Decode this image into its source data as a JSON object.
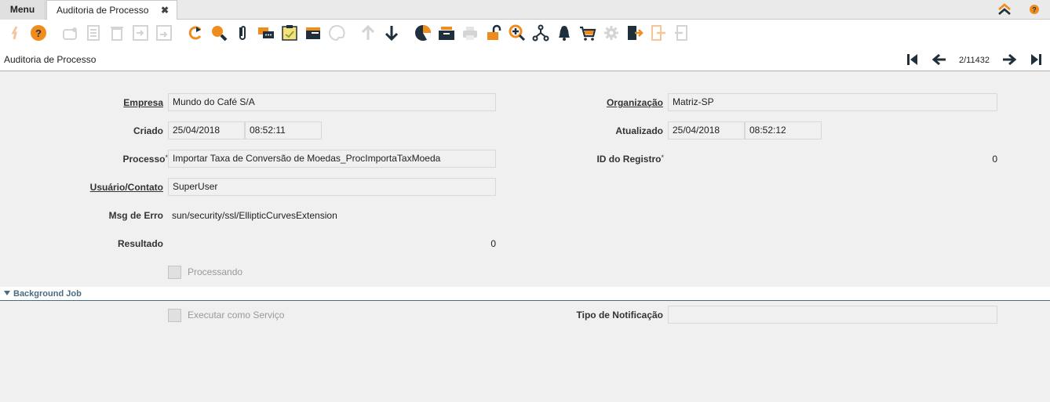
{
  "tabs": {
    "menu_label": "Menu",
    "active_label": "Auditoria de Processo",
    "close_glyph": "✖"
  },
  "toolbar": {
    "icons": [
      "undo-icon",
      "help-icon",
      "new-record-icon",
      "copy-record-icon",
      "delete-icon",
      "save-icon",
      "save-new-icon",
      "refresh-icon",
      "find-icon",
      "attachment-icon",
      "chat-icon",
      "post-it-icon",
      "archive-icon",
      "palette-icon",
      "parent-record-icon",
      "detail-record-icon",
      "chart-icon",
      "report-icon",
      "print-icon",
      "lock-icon",
      "zoom-across-icon",
      "workflow-icon",
      "notification-icon",
      "cart-icon",
      "process-icon",
      "exit-icon",
      "export-icon",
      "import-icon"
    ],
    "accent_color": "#f08c1e",
    "dark_color": "#1f2f3b"
  },
  "header": {
    "title": "Auditoria de Processo",
    "record_count": "2/11432"
  },
  "form": {
    "empresa_label": "Empresa",
    "empresa_value": "Mundo do Café S/A",
    "organizacao_label": "Organização",
    "organizacao_value": "Matriz-SP",
    "criado_label": "Criado",
    "criado_date": "25/04/2018",
    "criado_time": "08:52:11",
    "atualizado_label": "Atualizado",
    "atualizado_date": "25/04/2018",
    "atualizado_time": "08:52:12",
    "processo_label": "Processo",
    "required_mark": "*",
    "processo_value": "Importar Taxa de Conversão de Moedas_ProcImportaTaxMoeda",
    "id_registro_label": "ID do Registro",
    "id_registro_value": "0",
    "usuario_label": "Usuário/Contato",
    "usuario_value": "SuperUser",
    "msg_erro_label": "Msg de Erro",
    "msg_erro_value": "sun/security/ssl/EllipticCurvesExtension",
    "resultado_label": "Resultado",
    "resultado_value": "0",
    "processando_label": "Processando"
  },
  "background_job": {
    "section_title": "Background Job",
    "executar_label": "Executar como Serviço",
    "tipo_notificacao_label": "Tipo de Notificação",
    "tipo_notificacao_value": ""
  }
}
